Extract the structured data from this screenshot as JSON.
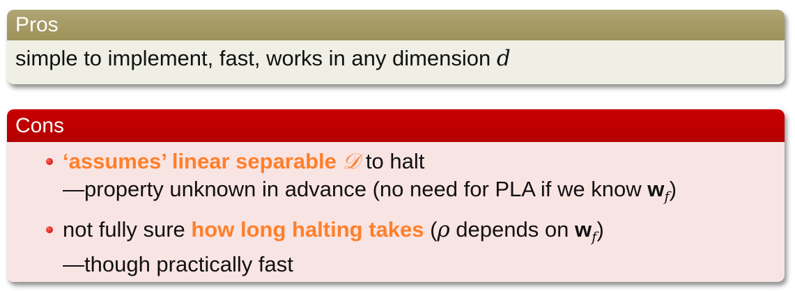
{
  "pros": {
    "title": "Pros",
    "text": "simple to implement, fast, works in any dimension ",
    "var": "d"
  },
  "cons": {
    "title": "Cons",
    "item1": {
      "hl": "‘assumes’ linear separable ",
      "sym": "𝒟",
      "rest": " to halt",
      "line2_pre": "—property unknown in advance (no need for PLA if we know ",
      "w": "w",
      "sub": "f",
      "close": ")"
    },
    "item2": {
      "pre": "not fully sure ",
      "hl": "how long halting takes",
      "paren_open": " (",
      "rho": "ρ",
      "mid": " depends on ",
      "w": "w",
      "sub": "f",
      "close": ")",
      "line2": "—though practically fast"
    }
  }
}
